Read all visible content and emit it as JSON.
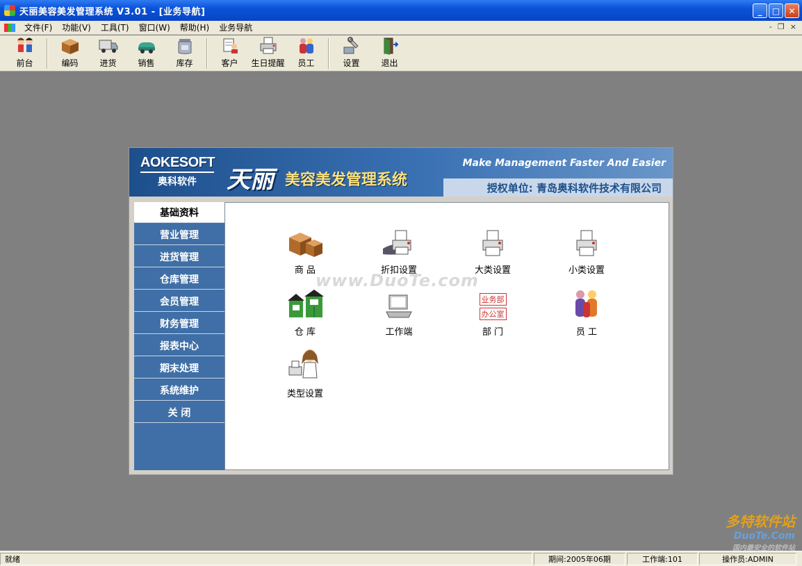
{
  "window": {
    "title": "天丽美容美发管理系统 V3.01 - [业务导航]"
  },
  "menu": [
    "文件(F)",
    "功能(V)",
    "工具(T)",
    "窗口(W)",
    "帮助(H)",
    "业务导航"
  ],
  "mdi_controls": [
    "-",
    "❐",
    "×"
  ],
  "toolbar": [
    {
      "label": "前台",
      "icon": "people-icon"
    },
    {
      "label": "编码",
      "icon": "box-icon"
    },
    {
      "label": "进货",
      "icon": "truck-icon"
    },
    {
      "label": "销售",
      "icon": "car-icon"
    },
    {
      "label": "库存",
      "icon": "jar-icon"
    },
    {
      "label": "客户",
      "icon": "customer-icon"
    },
    {
      "label": "生日提醒",
      "icon": "printer-icon"
    },
    {
      "label": "员工",
      "icon": "staff-icon"
    },
    {
      "label": "设置",
      "icon": "tools-icon"
    },
    {
      "label": "退出",
      "icon": "exit-door-icon"
    }
  ],
  "banner": {
    "logo_en": "AOKESOFT",
    "logo_cn": "奥科软件",
    "brand": "天丽",
    "brand_sub": "美容美发管理系统",
    "slogan": "Make Management Faster And Easier",
    "license": "授权单位:  青岛奥科软件技术有限公司"
  },
  "nav": [
    "基础资料",
    "营业管理",
    "进货管理",
    "仓库管理",
    "会员管理",
    "财务管理",
    "报表中心",
    "期末处理",
    "系统维护",
    "关      闭"
  ],
  "nav_active_index": 0,
  "watermark": "www.DuoTe.com",
  "items": [
    {
      "label": "商    品",
      "icon": "boxes-icon"
    },
    {
      "label": "折扣设置",
      "icon": "discount-printer-icon"
    },
    {
      "label": "大类设置",
      "icon": "category-printer-icon"
    },
    {
      "label": "小类设置",
      "icon": "subcategory-printer-icon"
    },
    {
      "label": "仓    库",
      "icon": "warehouse-icon"
    },
    {
      "label": "工作端",
      "icon": "terminal-icon"
    },
    {
      "label": "部    门",
      "icon": "department-icon"
    },
    {
      "label": "员    工",
      "icon": "employees-icon"
    },
    {
      "label": "类型设置",
      "icon": "type-setting-icon"
    }
  ],
  "dept_tags": [
    "业务部",
    "办公室"
  ],
  "status": {
    "ready": "就绪",
    "period": "期间:2005年06期",
    "terminal": "工作端:101",
    "operator": "操作员:ADMIN"
  },
  "corner_logo": {
    "a": "多特软件站",
    "b": "DuoTe.Com",
    "c": "国内最安全的软件站"
  }
}
